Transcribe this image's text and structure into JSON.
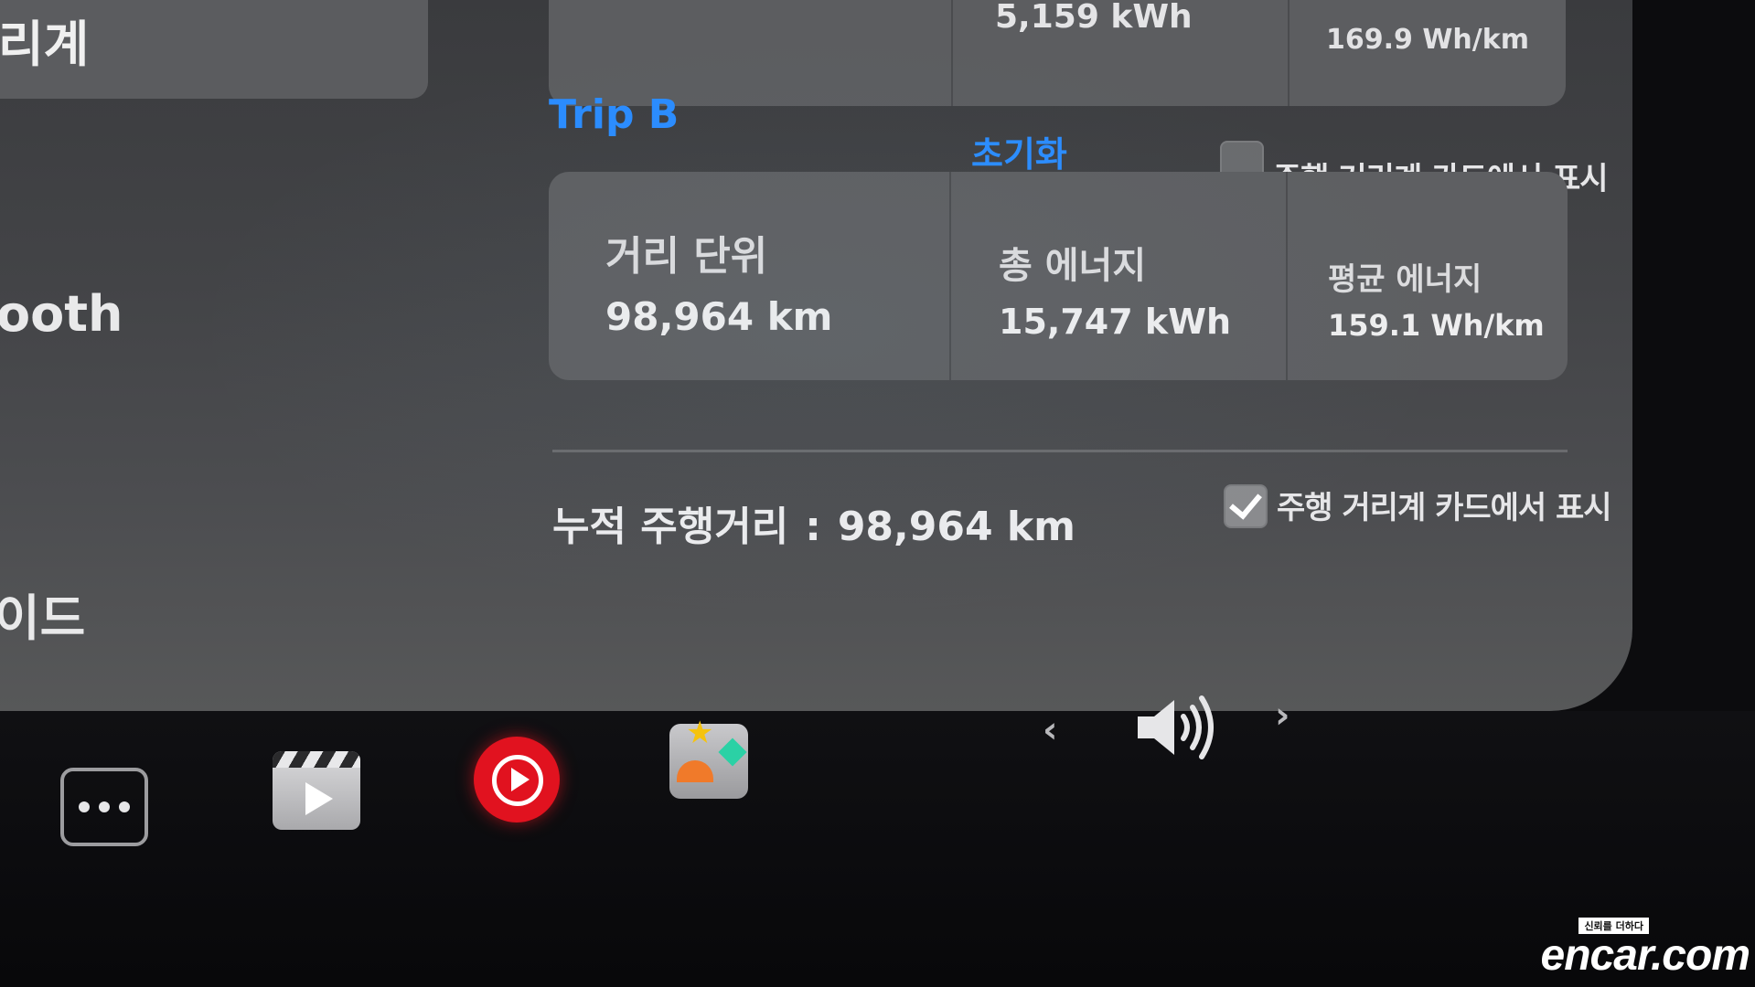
{
  "sidebar": {
    "selected_label": "리계",
    "items": [
      {
        "label": "ooth"
      },
      {
        "label": "이드"
      }
    ]
  },
  "trip_a": {
    "energy_partial": "5,159 kWh",
    "avg_energy": "169.9 Wh/km"
  },
  "trip_b": {
    "title": "Trip B",
    "reset_label": "초기화",
    "show_on_card_label": "주행 거리계 카드에서 표시",
    "show_on_card_checked": false,
    "distance_label": "거리 단위",
    "distance_value": "98,964 km",
    "energy_label": "총 에너지",
    "energy_value": "15,747 kWh",
    "avg_label": "평균 에너지",
    "avg_value": "159.1 Wh/km"
  },
  "odometer": {
    "label": "누적 주행거리",
    "separator": ":",
    "value": "98,964 km",
    "show_on_card_label": "주행 거리계 카드에서 표시",
    "show_on_card_checked": true
  },
  "dock": {
    "apps": [
      "more-apps-icon",
      "theater-icon",
      "youtube-music-icon",
      "toybox-icon"
    ],
    "volume_icon": "speaker-volume-icon",
    "prev_label": "‹",
    "next_label": "›"
  },
  "watermark": {
    "tagline": "신뢰를 더하다",
    "name": "encar.com"
  }
}
